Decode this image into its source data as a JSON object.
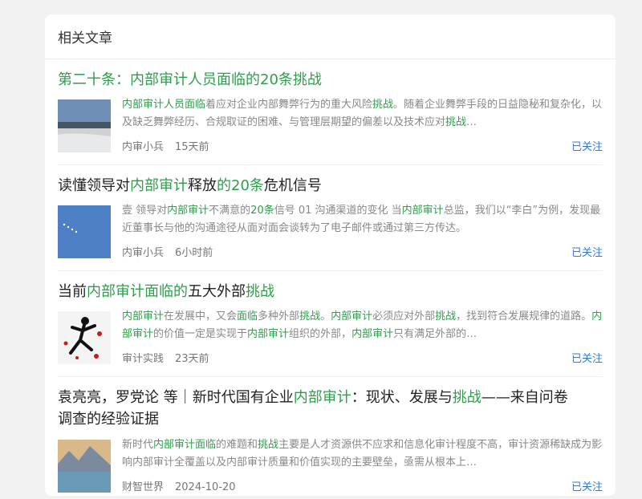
{
  "section_title": "相关文章",
  "follow_label": "已关注",
  "articles": [
    {
      "title_plain": "",
      "title_parts": [
        "第二十条：内部审计人员面临的20条挑战"
      ],
      "summary": "内部审计人员面临着应对企业内部舞弊行为的重大风险挑战。随着企业舞弊手段的日益隐秘和复杂化，以及缺乏舞弊经历、合规取证的困难、与管理层期望的偏差以及技术应对挑战…",
      "author": "内审小兵",
      "time": "15天前",
      "follow": "已关注"
    },
    {
      "title_a": "读懂领导对",
      "title_b": "内部审计",
      "title_c": "释放",
      "title_d": "的20条",
      "title_e": "危机信号",
      "summary_a": "壹 领导对",
      "summary_b": "内部审计",
      "summary_c": "不满意的",
      "summary_d": "20条",
      "summary_e": "信号 01 沟通渠道的变化 当",
      "summary_f": "内部审计",
      "summary_g": "总监，我们以“李白”为例，发现最近董事长与他的沟通途径从面对面会谈转为了电子邮件或通过第三方传达。",
      "author": "内审小兵",
      "time": "6小时前",
      "follow": "已关注"
    },
    {
      "title_a": "当前",
      "title_b": "内部审计面临的",
      "title_c": "五大外部",
      "title_d": "挑战",
      "summary": "内部审计在发展中，又会面临多种外部挑战。内部审计必须应对外部挑战，找到符合发展规律的道路。内部审计的价值一定是实现于内部审计组织的外部，内部审计只有满足外部的…",
      "author": "审计实践",
      "time": "23天前",
      "follow": "已关注"
    },
    {
      "title_a": "袁亮亮，罗党论 等｜新时代国有企业",
      "title_b": "内部审计",
      "title_c": "：现状、发展与",
      "title_d": "挑战",
      "title_e": "——来自问卷",
      "title_line2": "调查的经验证据",
      "summary": "新时代内部审计面临的难题和挑战主要是人才资源供不应求和信息化审计程度不高，审计资源稀缺成为影响内部审计全覆盖以及内部审计质量和价值实现的主要壁垒，亟需从根本上…",
      "author": "财智世界",
      "time": "2024-10-20",
      "follow": "已关注"
    }
  ]
}
